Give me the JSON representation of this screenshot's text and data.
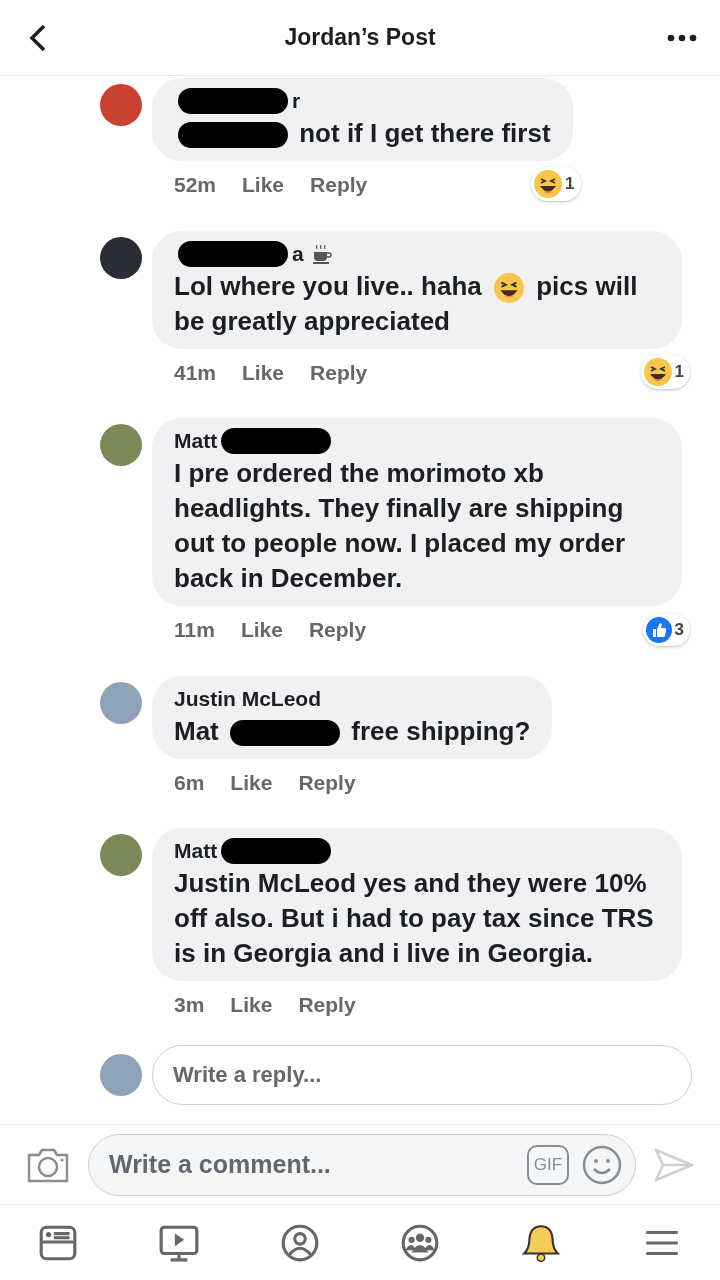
{
  "header": {
    "title": "Jordan’s Post"
  },
  "comments": [
    {
      "name": [
        {
          "kind": "redaction"
        },
        {
          "kind": "text",
          "text": "r"
        }
      ],
      "body": [
        {
          "kind": "redaction"
        },
        {
          "kind": "text",
          "text": "not if I get there first"
        }
      ],
      "time": "52m",
      "like": "Like",
      "reply": "Reply",
      "reaction": {
        "kind": "haha",
        "count": "1"
      }
    },
    {
      "name": [
        {
          "kind": "redaction"
        },
        {
          "kind": "text",
          "text": "a"
        },
        {
          "kind": "coffee"
        }
      ],
      "body": [
        {
          "kind": "text",
          "text": "Lol where you live.. haha"
        },
        {
          "kind": "emoji"
        },
        {
          "kind": "text",
          "text": "pics will"
        },
        {
          "kind": "text",
          "text": "be greatly appreciated"
        }
      ],
      "time": "41m",
      "like": "Like",
      "reply": "Reply",
      "reaction": {
        "kind": "haha",
        "count": "1"
      }
    },
    {
      "name": [
        {
          "kind": "text",
          "text": "Matt"
        },
        {
          "kind": "redaction"
        }
      ],
      "body": [
        {
          "kind": "text",
          "text": "I pre ordered the morimoto xb headlights.  They finally are shipping out to people  now. I placed my order back in December."
        }
      ],
      "time": "11m",
      "like": "Like",
      "reply": "Reply",
      "reaction": {
        "kind": "like",
        "count": "3"
      }
    },
    {
      "name": [
        {
          "kind": "text",
          "text": "Justin McLeod"
        }
      ],
      "body": [
        {
          "kind": "text",
          "text": "Mat"
        },
        {
          "kind": "redaction"
        },
        {
          "kind": "text",
          "text": "free shipping?"
        }
      ],
      "time": "6m",
      "like": "Like",
      "reply": "Reply"
    },
    {
      "name": [
        {
          "kind": "text",
          "text": "Matt"
        },
        {
          "kind": "redaction"
        }
      ],
      "body": [
        {
          "kind": "text",
          "text": "**Justin McLeod**  yes and they were 10% off also.  But i had to pay tax since TRS is in Georgia and i live in Georgia."
        }
      ],
      "time": "3m",
      "like": "Like",
      "reply": "Reply"
    }
  ],
  "reply_box": {
    "placeholder": "Write a reply..."
  },
  "comment_box": {
    "placeholder": "Write a comment...",
    "gif": "GIF"
  },
  "nav": [
    {
      "selected": false
    },
    {
      "selected": false
    },
    {
      "selected": false
    },
    {
      "selected": false
    },
    {
      "selected": true
    },
    {
      "selected": false
    }
  ]
}
